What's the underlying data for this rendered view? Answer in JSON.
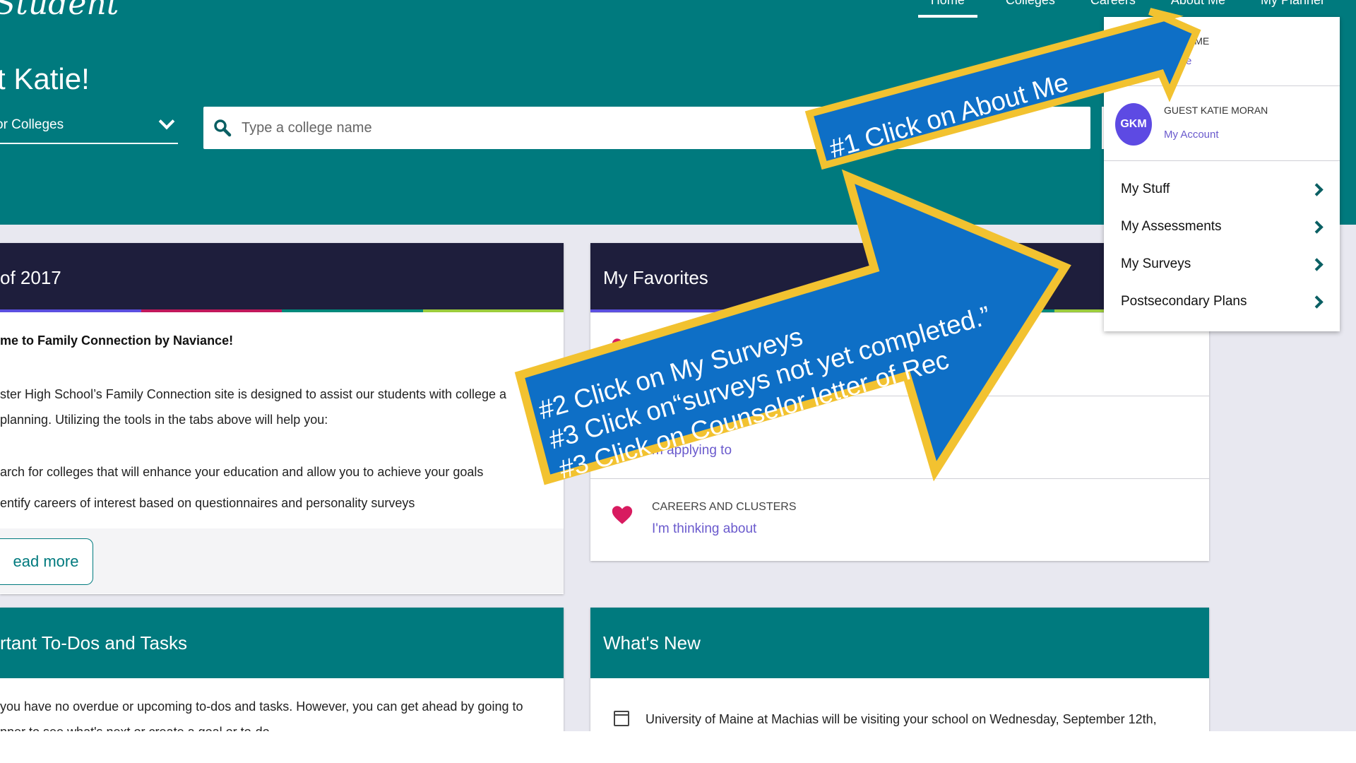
{
  "header": {
    "logo": "Student",
    "greeting": "t Katie!",
    "search_type": "or Colleges",
    "search_placeholder": "Type a college name",
    "nav": [
      "Home",
      "Colleges",
      "Careers",
      "About Me",
      "My Planner"
    ]
  },
  "class_panel": {
    "title": "of 2017",
    "welcome": "me to Family Connection by Naviance!",
    "para1_line1": "ster High School’s Family Connection site is designed to assist our students with college a",
    "para1_line2": "planning. Utilizing the tools in the tabs above will help you:",
    "bullet1": "arch for colleges that will enhance your education and allow you to achieve your goals",
    "bullet2": "entify careers of interest based on questionnaires and personality surveys",
    "read_more": "ead more"
  },
  "favorites": {
    "title": "My Favorites",
    "row2_link": "m applying to",
    "row3_category": "CAREERS AND CLUSTERS",
    "row3_link": "I'm thinking about"
  },
  "todo_panel": {
    "title": "rtant To-Dos and Tasks",
    "text_line1": "you have no overdue or upcoming to-dos and tasks. However, you can get ahead by going to",
    "text_line2": "nner to see what's next or create a goal or to-do."
  },
  "whats_new": {
    "title": "What's New",
    "item1": "University of Maine at Machias will be visiting your school on Wednesday, September 12th,"
  },
  "dropdown": {
    "section_label": "T ME",
    "section_sub": "e",
    "user_name": "GUEST KATIE MORAN",
    "avatar_initials": "GKM",
    "account_link": "My Account",
    "items": [
      "My Stuff",
      "My Assessments",
      "My Surveys",
      "Postsecondary Plans"
    ]
  },
  "annotations": {
    "arrow1": "#1 Click on About Me",
    "arrow2_line1": "#2 Click on My Surveys",
    "arrow2_line2": "#3 Click on“surveys not yet completed.”",
    "arrow2_line3": "#3 Click on Counselor letter of Rec"
  },
  "colors": {
    "teal": "#007a7e",
    "navy": "#1e1e3c",
    "arrow_fill": "#0e6fc6",
    "arrow_border": "#f2c230",
    "heart": "#d81b60",
    "link": "#6a5acd",
    "avatar": "#5d4ae3",
    "stripe": [
      "#5b4fe0",
      "#c2185b",
      "#00897b",
      "#9ccc3c"
    ]
  },
  "icons": {
    "search": "search-icon",
    "dropdown": "chevron-down-icon",
    "menu_item": "chevron-right-icon",
    "favorite": "heart-icon",
    "calendar": "calendar-icon"
  }
}
